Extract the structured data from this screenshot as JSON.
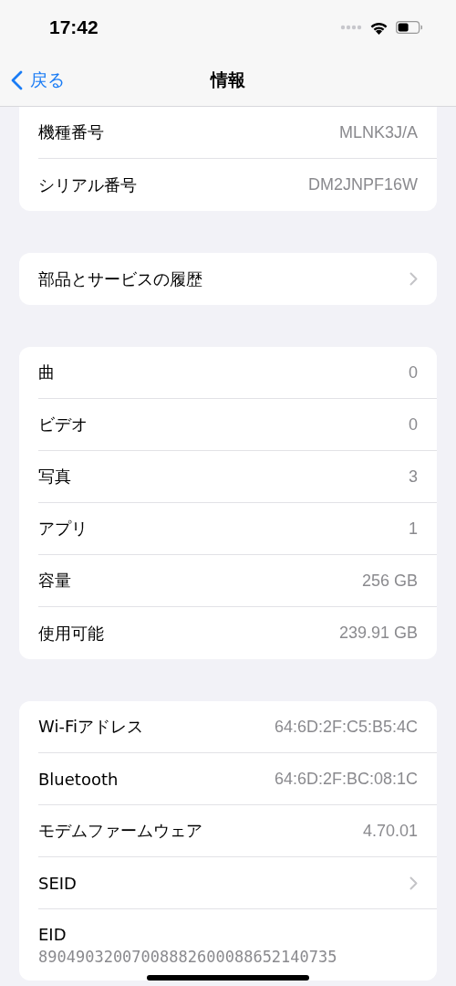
{
  "status_bar": {
    "time": "17:42"
  },
  "nav": {
    "back": "戻る",
    "title": "情報"
  },
  "groups": [
    {
      "rows": [
        {
          "kind": "value",
          "label": "機種番号",
          "value": "MLNK3J/A"
        },
        {
          "kind": "value",
          "label": "シリアル番号",
          "value": "DM2JNPF16W"
        }
      ]
    },
    {
      "rows": [
        {
          "kind": "chevron",
          "label": "部品とサービスの履歴"
        }
      ]
    },
    {
      "rows": [
        {
          "kind": "value",
          "label": "曲",
          "value": "0"
        },
        {
          "kind": "value",
          "label": "ビデオ",
          "value": "0"
        },
        {
          "kind": "value",
          "label": "写真",
          "value": "3"
        },
        {
          "kind": "value",
          "label": "アプリ",
          "value": "1"
        },
        {
          "kind": "value",
          "label": "容量",
          "value": "256 GB"
        },
        {
          "kind": "value",
          "label": "使用可能",
          "value": "239.91 GB"
        }
      ]
    },
    {
      "rows": [
        {
          "kind": "value",
          "label": "Wi-Fiアドレス",
          "value": "64:6D:2F:C5:B5:4C"
        },
        {
          "kind": "value",
          "label": "Bluetooth",
          "value": "64:6D:2F:BC:08:1C"
        },
        {
          "kind": "value",
          "label": "モデムファームウェア",
          "value": "4.70.01"
        },
        {
          "kind": "chevron",
          "label": "SEID"
        },
        {
          "kind": "stacked",
          "label": "EID",
          "value": "89049032007008882600088652140735"
        }
      ]
    }
  ]
}
